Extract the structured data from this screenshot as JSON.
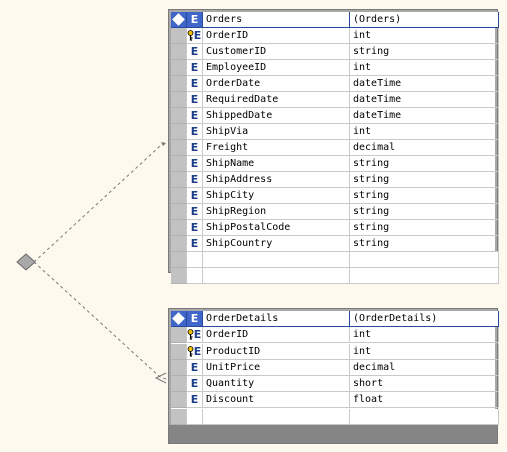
{
  "colors": {
    "background": "#fdf9ee",
    "header_accent": "#3f66c8",
    "entity_frame": "#a8a8a8",
    "key_icon": "#f0c000",
    "connector": "#777777"
  },
  "relationship": {
    "icon": "diamond-icon"
  },
  "entities": [
    {
      "name": "Orders",
      "type_label": "(Orders)",
      "fields": [
        {
          "name": "OrderID",
          "type": "int",
          "key": true
        },
        {
          "name": "CustomerID",
          "type": "string",
          "key": false
        },
        {
          "name": "EmployeeID",
          "type": "int",
          "key": false
        },
        {
          "name": "OrderDate",
          "type": "dateTime",
          "key": false
        },
        {
          "name": "RequiredDate",
          "type": "dateTime",
          "key": false
        },
        {
          "name": "ShippedDate",
          "type": "dateTime",
          "key": false
        },
        {
          "name": "ShipVia",
          "type": "int",
          "key": false
        },
        {
          "name": "Freight",
          "type": "decimal",
          "key": false
        },
        {
          "name": "ShipName",
          "type": "string",
          "key": false
        },
        {
          "name": "ShipAddress",
          "type": "string",
          "key": false
        },
        {
          "name": "ShipCity",
          "type": "string",
          "key": false
        },
        {
          "name": "ShipRegion",
          "type": "string",
          "key": false
        },
        {
          "name": "ShipPostalCode",
          "type": "string",
          "key": false
        },
        {
          "name": "ShipCountry",
          "type": "string",
          "key": false
        }
      ]
    },
    {
      "name": "OrderDetails",
      "type_label": "(OrderDetails)",
      "fields": [
        {
          "name": "OrderID",
          "type": "int",
          "key": true
        },
        {
          "name": "ProductID",
          "type": "int",
          "key": true
        },
        {
          "name": "UnitPrice",
          "type": "decimal",
          "key": false
        },
        {
          "name": "Quantity",
          "type": "short",
          "key": false
        },
        {
          "name": "Discount",
          "type": "float",
          "key": false
        }
      ]
    }
  ],
  "element_marker": "E"
}
